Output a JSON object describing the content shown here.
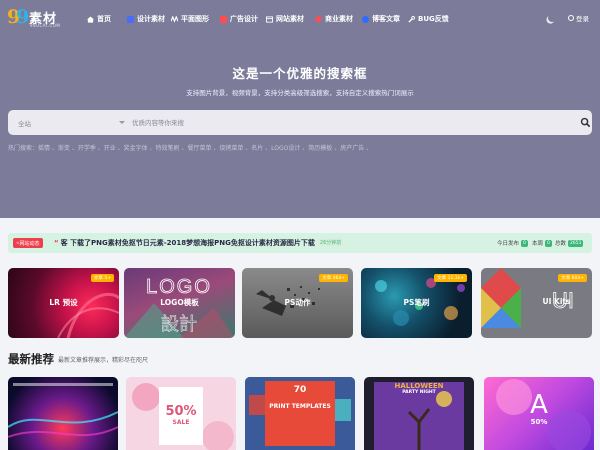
{
  "header": {
    "logo_text": "素材",
    "logo_sub": "9SUCAI.COM",
    "nav": [
      {
        "label": "首页",
        "icon": "home-icon",
        "color": "#ffffff"
      },
      {
        "label": "设计素材",
        "icon": "design-icon",
        "color": "#4a6cf7"
      },
      {
        "label": "平面图形",
        "icon": "graphic-icon",
        "color": "#ffffff"
      },
      {
        "label": "广告设计",
        "icon": "ad-icon",
        "color": "#ff4d4f"
      },
      {
        "label": "网站素材",
        "icon": "web-icon",
        "color": "#ffffff"
      },
      {
        "label": "商业素材",
        "icon": "shield-icon",
        "color": "#ff4d4f"
      },
      {
        "label": "博客文章",
        "icon": "blog-icon",
        "color": "#2f6bff"
      },
      {
        "label": "BUG反馈",
        "icon": "wrench-icon",
        "color": "#ffffff"
      }
    ],
    "login": "登录",
    "theme_icon": "moon-icon"
  },
  "hero": {
    "title": "这是一个优雅的搜索框",
    "subtitle": "支持图片背景，视频背景，支持分类高级筛选搜索，支持自定义搜索热门词展示"
  },
  "search": {
    "scope": "全站",
    "placeholder": "优质内容等你来搜",
    "hot": "热门搜索：摇情 、渐变 、开学季 、开业 、奖金字体 、特效笔刷 、餐厅菜单 、烧烤菜单 、名片 、LOGO设计 、简历模板 、房产广告 、"
  },
  "notice": {
    "tag": "网站动态",
    "quote": "“",
    "text": "客 下载了PNG素材免抠节日元素-2018梦想海报PNG免抠设计素材资源图片下载",
    "time": "26分钟前",
    "today_label": "今日发布",
    "today_value": "0",
    "week_label": "本周",
    "week_value": "0",
    "total_label": "总数",
    "total_value": "2651"
  },
  "categories": [
    {
      "label": "LR 预设",
      "badge": "文章 5+"
    },
    {
      "label": "LOGO模板",
      "badge": ""
    },
    {
      "label": "PS动作",
      "badge": "文章 464+"
    },
    {
      "label": "PS笔刷",
      "badge": "文章 11.3k+"
    },
    {
      "label": "UI Kits",
      "badge": "文章 604+"
    }
  ],
  "latest": {
    "title": "最新推荐",
    "subtitle": "最新文章推荐展示，精彩尽在咫尺"
  },
  "cards": [
    {
      "line1": "",
      "line2": ""
    },
    {
      "line1": "50%",
      "line2": "SALE"
    },
    {
      "line1": "70",
      "line2": "PRINT TEMPLATES"
    },
    {
      "line1": "HALLOWEEN",
      "line2": "PARTY NIGHT"
    },
    {
      "line1": "A",
      "line2": "50%"
    }
  ]
}
